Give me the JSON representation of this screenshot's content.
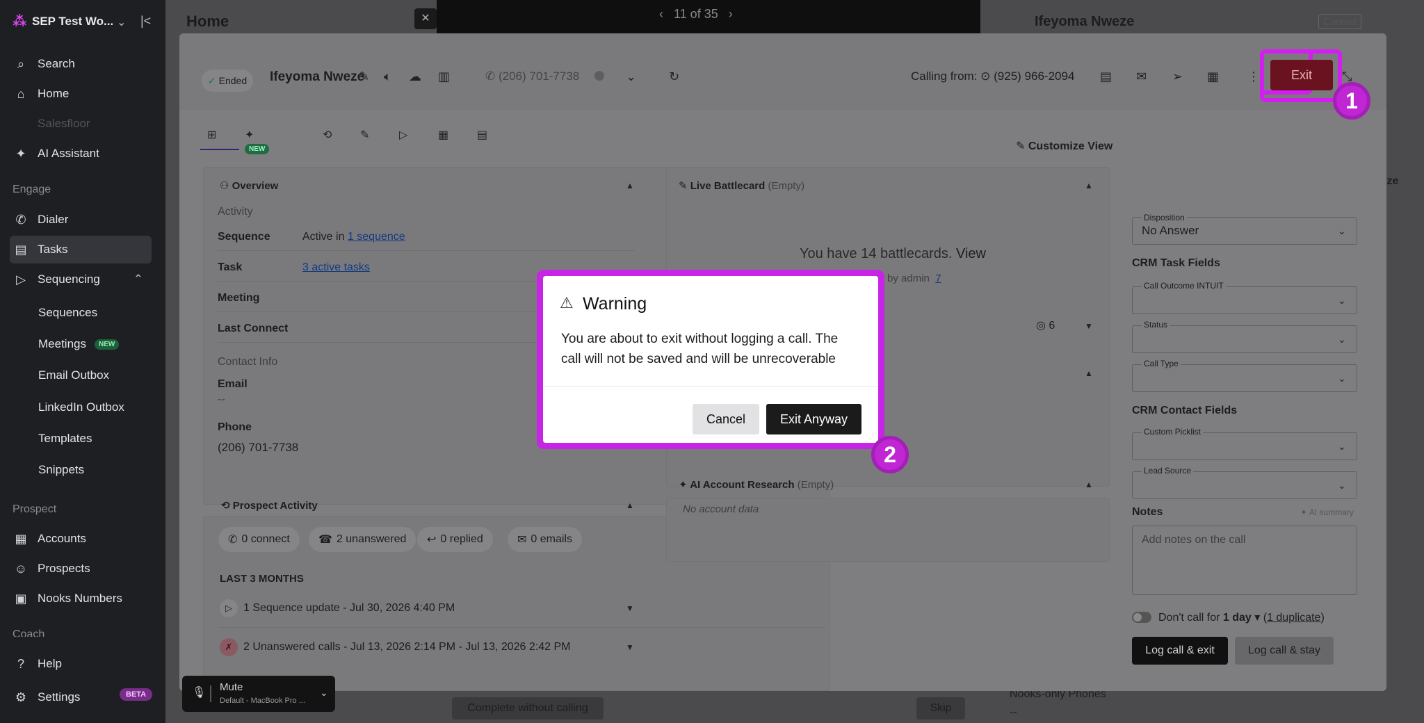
{
  "sidebar": {
    "workspace": "SEP Test Wo...",
    "items": {
      "search": "Search",
      "home": "Home",
      "salesfloor": "Salesfloor",
      "ai_assistant": "AI Assistant",
      "dialer": "Dialer",
      "tasks": "Tasks",
      "sequencing": "Sequencing",
      "sequences": "Sequences",
      "meetings": "Meetings",
      "email_outbox": "Email Outbox",
      "linkedin_outbox": "LinkedIn Outbox",
      "templates": "Templates",
      "snippets": "Snippets",
      "accounts": "Accounts",
      "prospects": "Prospects",
      "nooks_numbers": "Nooks Numbers",
      "help": "Help",
      "settings": "Settings"
    },
    "sections": {
      "engage": "Engage",
      "prospect": "Prospect",
      "coach": "Coach"
    },
    "new_badge": "NEW",
    "beta_badge": "BETA",
    "accent_color": "#d946ef"
  },
  "background": {
    "page_title": "Home",
    "counter": "11 of 35",
    "right_name": "Ifeyoma Nweze",
    "contact_chip": "Contact",
    "complete_without_calling": "Complete without calling",
    "skip": "Skip",
    "nooks_only_phones": "Nooks-only Phones",
    "dash": "--",
    "ize": "ize"
  },
  "call": {
    "status": "Ended",
    "name": "Ifeyoma Nweze",
    "phone": "(206) 701-7738",
    "calling_from_label": "Calling from:",
    "calling_from_number": "(925) 966-2094",
    "exit_label": "Exit",
    "tab_new_badge": "NEW",
    "customize_view": "Customize View",
    "overview": {
      "title": "Overview",
      "activity": "Activity",
      "sequence_label": "Sequence",
      "sequence_prefix": "Active in ",
      "sequence_link": "1 sequence",
      "task_label": "Task",
      "task_link": "3 active tasks",
      "meeting_label": "Meeting",
      "last_connect_label": "Last Connect",
      "contact_info": "Contact Info",
      "email_label": "Email",
      "email_value": "--",
      "phone_label": "Phone",
      "phone_value": "(206) 701-7738"
    },
    "prospect_activity": {
      "title": "Prospect Activity",
      "connect": "0 connect",
      "unanswered": "2 unanswered",
      "replied": "0 replied",
      "emails": "0 emails",
      "period": "LAST 3 MONTHS",
      "row1": "1 Sequence update - Jul 30, 2026 4:40 PM",
      "row2": "2 Unanswered calls - Jul 13, 2026 2:14 PM - Jul 13, 2026 2:42 PM",
      "row3_tail": "PM"
    },
    "battlecard": {
      "title": "Live Battlecard",
      "empty": "(Empty)",
      "summary": "You have 14 battlecards.",
      "view": "View",
      "by_admin": "by admin",
      "admin_count": "7",
      "count": "6"
    },
    "ai_research": {
      "title": "AI Account Research",
      "empty": "(Empty)",
      "no_data": "No account data"
    },
    "right": {
      "disposition_label": "Disposition",
      "disposition_value": "No Answer",
      "crm_task_fields": "CRM Task Fields",
      "call_outcome_label": "Call Outcome INTUIT",
      "status_label": "Status",
      "call_type_label": "Call Type",
      "crm_contact_fields": "CRM Contact Fields",
      "custom_picklist_label": "Custom Picklist",
      "lead_source_label": "Lead Source",
      "notes_label": "Notes",
      "ai_summary": "AI summary",
      "notes_placeholder": "Add notes on the call",
      "dont_call_prefix": "Don't call for ",
      "dont_call_value": "1 day",
      "duplicate_link": "1 duplicate",
      "log_exit": "Log call & exit",
      "log_stay": "Log call & stay"
    },
    "mute": {
      "title": "Mute",
      "device": "Default - MacBook Pro ..."
    }
  },
  "warning": {
    "title": "Warning",
    "body": "You are about to exit without logging a call. The call will not be saved and will be unrecoverable",
    "cancel": "Cancel",
    "exit_anyway": "Exit Anyway"
  },
  "annotations": {
    "badge1": "1",
    "badge2": "2",
    "highlight_color": "#c724e6"
  }
}
